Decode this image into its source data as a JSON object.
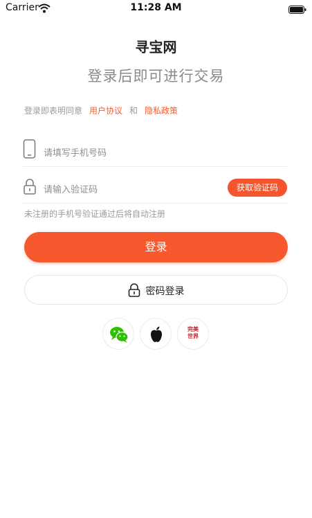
{
  "status_bar": {
    "carrier": "Carrier",
    "time": "11:28 AM"
  },
  "header": {
    "brand": "寻宝网",
    "subtitle": "登录后即可进行交易"
  },
  "agreement": {
    "prefix": "登录即表明同意",
    "user_agreement": "用户协议",
    "and": "和",
    "privacy_policy": "隐私政策"
  },
  "form": {
    "phone_placeholder": "请填写手机号码",
    "code_placeholder": "请输入验证码",
    "get_code_label": "获取验证码",
    "hint": "未注册的手机号验证通过后将自动注册"
  },
  "actions": {
    "login_label": "登录",
    "password_login_label": "密码登录"
  },
  "social": {
    "items": [
      "wechat-icon",
      "apple-icon",
      "wanmei-logo"
    ],
    "wanmei_line1": "完美",
    "wanmei_line2": "世界"
  },
  "colors": {
    "accent": "#f8582d",
    "link": "#ff5a2c",
    "wechat": "#2dc100"
  }
}
